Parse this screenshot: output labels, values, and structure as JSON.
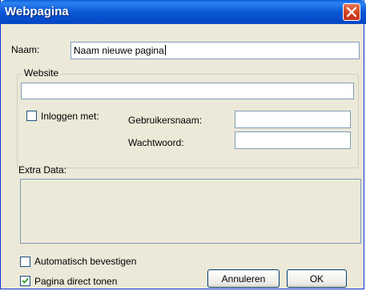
{
  "window": {
    "title": "Webpagina"
  },
  "form": {
    "naam_label": "Naam:",
    "naam_value": "Naam nieuwe pagina",
    "website_group_label": "Website",
    "website_value": "",
    "inloggen_label": "Inloggen met:",
    "inloggen_checked": false,
    "gebruikersnaam_label": "Gebruikersnaam:",
    "gebruikersnaam_value": "",
    "wachtwoord_label": "Wachtwoord:",
    "wachtwoord_value": "",
    "extra_data_label": "Extra Data:",
    "extra_data_value": "",
    "automatisch_label": "Automatisch bevestigen",
    "automatisch_checked": false,
    "direct_label": "Pagina direct tonen",
    "direct_checked": true
  },
  "buttons": {
    "cancel_label": "Annuleren",
    "ok_label": "OK"
  },
  "icons": {
    "close": "close-icon",
    "check": "checkmark-icon"
  },
  "colors": {
    "titlebar": "#0a58d6",
    "close": "#d2401e",
    "dialog_bg": "#ece9d8"
  }
}
